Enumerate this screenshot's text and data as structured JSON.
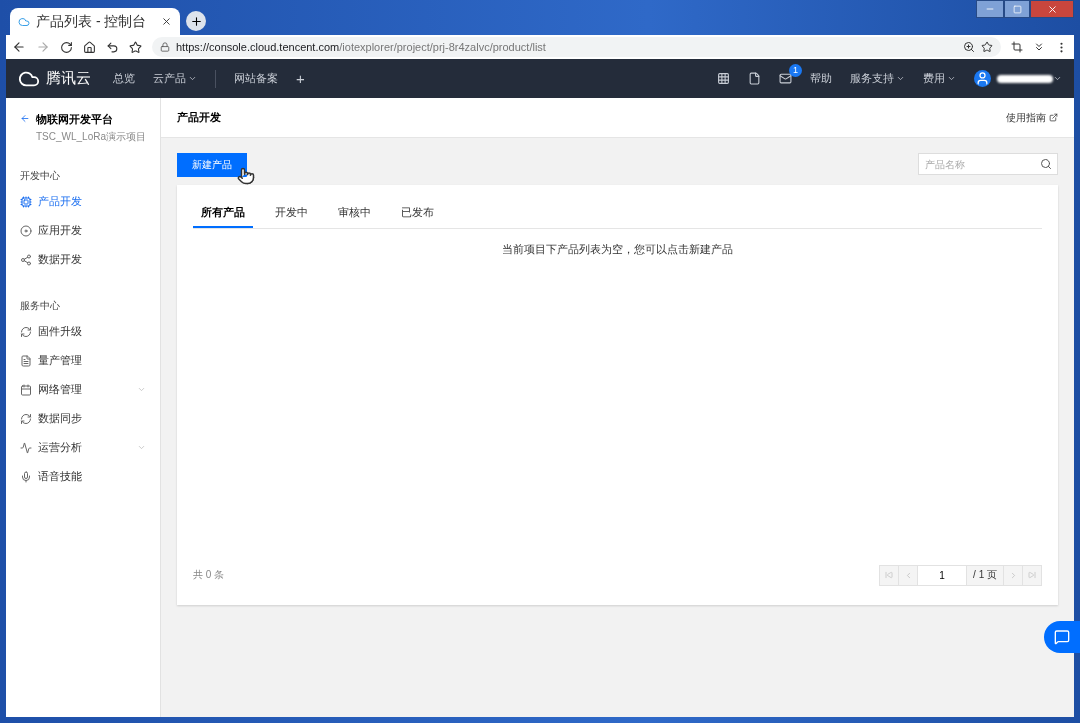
{
  "browser": {
    "tab_title": "产品列表 - 控制台",
    "url_host": "https://console.cloud.tencent.com",
    "url_path": "/iotexplorer/project/prj-8r4zalvc/product/list"
  },
  "topnav": {
    "brand": "腾讯云",
    "links": [
      {
        "label": "总览",
        "dropdown": false
      },
      {
        "label": "云产品",
        "dropdown": true
      },
      {
        "label": "网站备案",
        "dropdown": false
      }
    ],
    "plus": "+",
    "mail_badge": "1",
    "help": "帮助",
    "menus": [
      {
        "label": "服务支持"
      },
      {
        "label": "费用"
      }
    ]
  },
  "sidebar": {
    "title": "物联网开发平台",
    "project": "TSC_WL_LoRa演示项目",
    "sections": [
      {
        "title": "开发中心",
        "items": [
          {
            "label": "产品开发",
            "selected": true,
            "expandable": false
          },
          {
            "label": "应用开发",
            "selected": false,
            "expandable": false
          },
          {
            "label": "数据开发",
            "selected": false,
            "expandable": false
          }
        ]
      },
      {
        "title": "服务中心",
        "items": [
          {
            "label": "固件升级",
            "selected": false,
            "expandable": false
          },
          {
            "label": "量产管理",
            "selected": false,
            "expandable": false
          },
          {
            "label": "网络管理",
            "selected": false,
            "expandable": true
          },
          {
            "label": "数据同步",
            "selected": false,
            "expandable": false
          },
          {
            "label": "运营分析",
            "selected": false,
            "expandable": true
          },
          {
            "label": "语音技能",
            "selected": false,
            "expandable": false
          }
        ]
      }
    ]
  },
  "page": {
    "title": "产品开发",
    "guide_link": "使用指南",
    "create_button": "新建产品",
    "search": {
      "placeholder": "产品名称"
    },
    "tabs": [
      {
        "label": "所有产品",
        "selected": true
      },
      {
        "label": "开发中",
        "selected": false
      },
      {
        "label": "审核中",
        "selected": false
      },
      {
        "label": "已发布",
        "selected": false
      }
    ],
    "empty_message": "当前项目下产品列表为空，您可以点击新建产品",
    "total": "共 0 条",
    "pagination": {
      "page": "1",
      "of_pages": "/ 1 页"
    }
  }
}
